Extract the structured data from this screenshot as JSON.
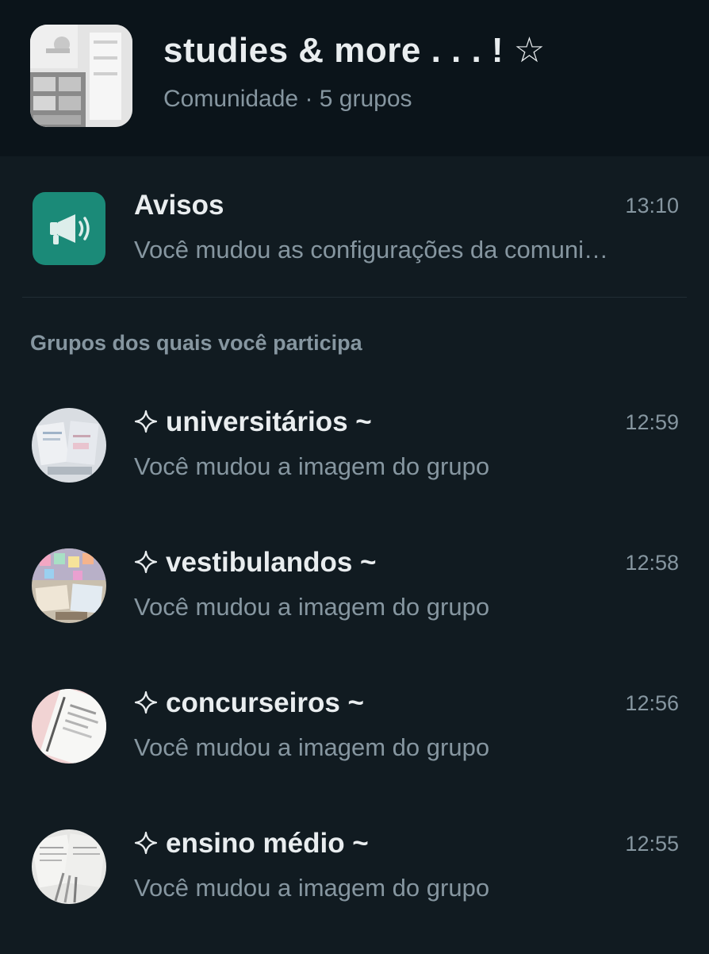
{
  "community": {
    "title": "studies & more . . . ! ☆",
    "subtitle": "Comunidade · 5 grupos"
  },
  "announcements": {
    "name": "Avisos",
    "last_message": "Você mudou as configurações da comuni…",
    "time": "13:10",
    "icon": "megaphone-icon",
    "icon_bg": "#1b8a78"
  },
  "section_label": "Grupos dos quais você participa",
  "groups": [
    {
      "name": "universitários ~",
      "last_message": "Você mudou a imagem do grupo",
      "time": "12:59"
    },
    {
      "name": "vestibulandos ~",
      "last_message": "Você mudou a imagem do grupo",
      "time": "12:58"
    },
    {
      "name": "concurseiros ~",
      "last_message": "Você mudou a imagem do grupo",
      "time": "12:56"
    },
    {
      "name": "ensino médio ~",
      "last_message": "Você mudou a imagem do grupo",
      "time": "12:55"
    }
  ],
  "colors": {
    "background": "#111b21",
    "header_background": "#0b141a",
    "primary_text": "#e9edef",
    "secondary_text": "#8696a0",
    "accent": "#1b8a78"
  }
}
